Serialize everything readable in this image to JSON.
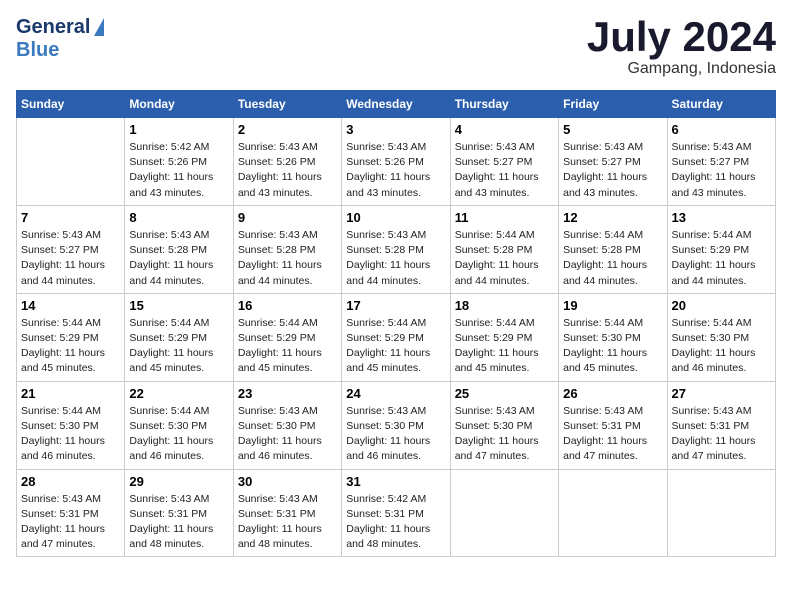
{
  "header": {
    "logo_general": "General",
    "logo_blue": "Blue",
    "month_title": "July 2024",
    "location": "Gampang, Indonesia"
  },
  "days_of_week": [
    "Sunday",
    "Monday",
    "Tuesday",
    "Wednesday",
    "Thursday",
    "Friday",
    "Saturday"
  ],
  "weeks": [
    [
      {
        "day": "",
        "info": ""
      },
      {
        "day": "1",
        "info": "Sunrise: 5:42 AM\nSunset: 5:26 PM\nDaylight: 11 hours\nand 43 minutes."
      },
      {
        "day": "2",
        "info": "Sunrise: 5:43 AM\nSunset: 5:26 PM\nDaylight: 11 hours\nand 43 minutes."
      },
      {
        "day": "3",
        "info": "Sunrise: 5:43 AM\nSunset: 5:26 PM\nDaylight: 11 hours\nand 43 minutes."
      },
      {
        "day": "4",
        "info": "Sunrise: 5:43 AM\nSunset: 5:27 PM\nDaylight: 11 hours\nand 43 minutes."
      },
      {
        "day": "5",
        "info": "Sunrise: 5:43 AM\nSunset: 5:27 PM\nDaylight: 11 hours\nand 43 minutes."
      },
      {
        "day": "6",
        "info": "Sunrise: 5:43 AM\nSunset: 5:27 PM\nDaylight: 11 hours\nand 43 minutes."
      }
    ],
    [
      {
        "day": "7",
        "info": "Sunrise: 5:43 AM\nSunset: 5:27 PM\nDaylight: 11 hours\nand 44 minutes."
      },
      {
        "day": "8",
        "info": "Sunrise: 5:43 AM\nSunset: 5:28 PM\nDaylight: 11 hours\nand 44 minutes."
      },
      {
        "day": "9",
        "info": "Sunrise: 5:43 AM\nSunset: 5:28 PM\nDaylight: 11 hours\nand 44 minutes."
      },
      {
        "day": "10",
        "info": "Sunrise: 5:43 AM\nSunset: 5:28 PM\nDaylight: 11 hours\nand 44 minutes."
      },
      {
        "day": "11",
        "info": "Sunrise: 5:44 AM\nSunset: 5:28 PM\nDaylight: 11 hours\nand 44 minutes."
      },
      {
        "day": "12",
        "info": "Sunrise: 5:44 AM\nSunset: 5:28 PM\nDaylight: 11 hours\nand 44 minutes."
      },
      {
        "day": "13",
        "info": "Sunrise: 5:44 AM\nSunset: 5:29 PM\nDaylight: 11 hours\nand 44 minutes."
      }
    ],
    [
      {
        "day": "14",
        "info": "Sunrise: 5:44 AM\nSunset: 5:29 PM\nDaylight: 11 hours\nand 45 minutes."
      },
      {
        "day": "15",
        "info": "Sunrise: 5:44 AM\nSunset: 5:29 PM\nDaylight: 11 hours\nand 45 minutes."
      },
      {
        "day": "16",
        "info": "Sunrise: 5:44 AM\nSunset: 5:29 PM\nDaylight: 11 hours\nand 45 minutes."
      },
      {
        "day": "17",
        "info": "Sunrise: 5:44 AM\nSunset: 5:29 PM\nDaylight: 11 hours\nand 45 minutes."
      },
      {
        "day": "18",
        "info": "Sunrise: 5:44 AM\nSunset: 5:29 PM\nDaylight: 11 hours\nand 45 minutes."
      },
      {
        "day": "19",
        "info": "Sunrise: 5:44 AM\nSunset: 5:30 PM\nDaylight: 11 hours\nand 45 minutes."
      },
      {
        "day": "20",
        "info": "Sunrise: 5:44 AM\nSunset: 5:30 PM\nDaylight: 11 hours\nand 46 minutes."
      }
    ],
    [
      {
        "day": "21",
        "info": "Sunrise: 5:44 AM\nSunset: 5:30 PM\nDaylight: 11 hours\nand 46 minutes."
      },
      {
        "day": "22",
        "info": "Sunrise: 5:44 AM\nSunset: 5:30 PM\nDaylight: 11 hours\nand 46 minutes."
      },
      {
        "day": "23",
        "info": "Sunrise: 5:43 AM\nSunset: 5:30 PM\nDaylight: 11 hours\nand 46 minutes."
      },
      {
        "day": "24",
        "info": "Sunrise: 5:43 AM\nSunset: 5:30 PM\nDaylight: 11 hours\nand 46 minutes."
      },
      {
        "day": "25",
        "info": "Sunrise: 5:43 AM\nSunset: 5:30 PM\nDaylight: 11 hours\nand 47 minutes."
      },
      {
        "day": "26",
        "info": "Sunrise: 5:43 AM\nSunset: 5:31 PM\nDaylight: 11 hours\nand 47 minutes."
      },
      {
        "day": "27",
        "info": "Sunrise: 5:43 AM\nSunset: 5:31 PM\nDaylight: 11 hours\nand 47 minutes."
      }
    ],
    [
      {
        "day": "28",
        "info": "Sunrise: 5:43 AM\nSunset: 5:31 PM\nDaylight: 11 hours\nand 47 minutes."
      },
      {
        "day": "29",
        "info": "Sunrise: 5:43 AM\nSunset: 5:31 PM\nDaylight: 11 hours\nand 48 minutes."
      },
      {
        "day": "30",
        "info": "Sunrise: 5:43 AM\nSunset: 5:31 PM\nDaylight: 11 hours\nand 48 minutes."
      },
      {
        "day": "31",
        "info": "Sunrise: 5:42 AM\nSunset: 5:31 PM\nDaylight: 11 hours\nand 48 minutes."
      },
      {
        "day": "",
        "info": ""
      },
      {
        "day": "",
        "info": ""
      },
      {
        "day": "",
        "info": ""
      }
    ]
  ]
}
